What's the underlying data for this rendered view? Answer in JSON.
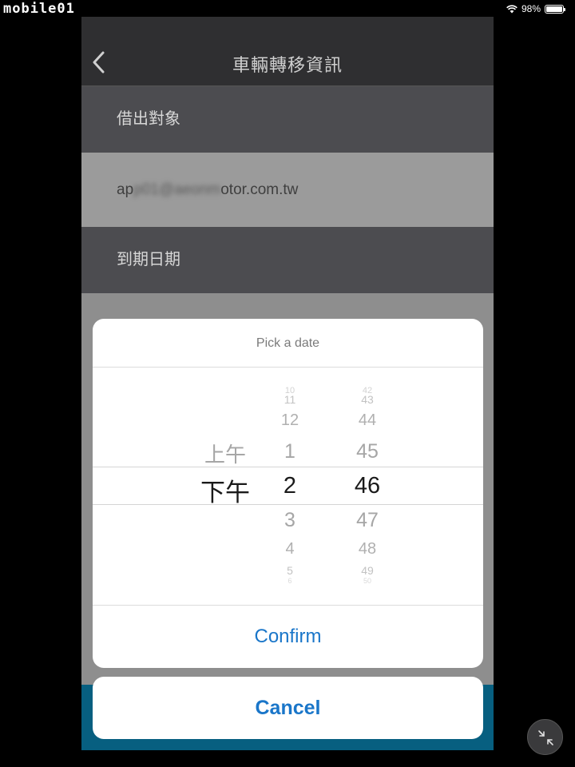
{
  "status_bar": {
    "watermark": "mobile01",
    "battery": "98%",
    "battery_level": 0.98
  },
  "nav": {
    "title": "車輛轉移資訊",
    "back_icon": "chevron-left-icon"
  },
  "form": {
    "lender_header": "借出對象",
    "email_visible_prefix": "ap",
    "email_blurred": "p01@aeonm",
    "email_visible_suffix": "otor.com.tw",
    "due_date_header": "到期日期"
  },
  "picker": {
    "title": "Pick a date",
    "period": {
      "above": [
        "上午"
      ],
      "selected": "下午"
    },
    "hour": {
      "above": [
        "10",
        "11",
        "12",
        "1"
      ],
      "selected": "2",
      "below": [
        "3",
        "4",
        "5",
        "6"
      ]
    },
    "minute": {
      "above": [
        "42",
        "43",
        "44",
        "45"
      ],
      "selected": "46",
      "below": [
        "47",
        "48",
        "49",
        "50"
      ]
    },
    "confirm_label": "Confirm",
    "cancel_label": "Cancel"
  },
  "colors": {
    "accent": "#1a76c9",
    "nav_bg": "#2f2f31",
    "header_bg": "#4c4c50",
    "bottom_strip": "#075f80"
  },
  "fab_icon": "collapse-arrows-icon"
}
